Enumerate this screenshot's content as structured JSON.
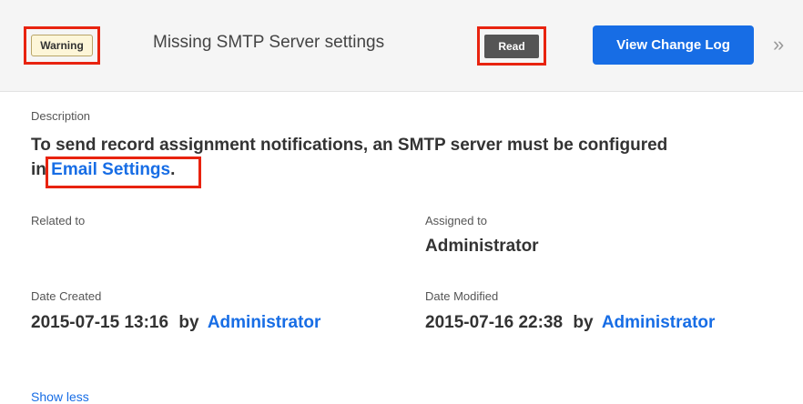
{
  "header": {
    "status_badge": "Warning",
    "title": "Missing SMTP Server settings",
    "read_badge": "Read",
    "change_log_button": "View Change Log",
    "more_glyph": "»"
  },
  "description": {
    "label": "Description",
    "text_line1": "To send record assignment notifications, an SMTP server must be configured",
    "text_prefix": "in ",
    "link_text": "Email Settings",
    "text_suffix": "."
  },
  "fields": {
    "related_to_label": "Related to",
    "assigned_to_label": "Assigned to",
    "assigned_to_value": "Administrator",
    "date_created_label": "Date Created",
    "date_created_value": "2015-07-15 13:16",
    "date_created_by": "by",
    "date_created_user": "Administrator",
    "date_modified_label": "Date Modified",
    "date_modified_value": "2015-07-16 22:38",
    "date_modified_by": "by",
    "date_modified_user": "Administrator"
  },
  "footer": {
    "show_less": "Show less"
  },
  "colors": {
    "link": "#176de5",
    "highlight": "#e8230f",
    "read_badge": "#555555",
    "warning_badge": "#fdf6d8"
  }
}
